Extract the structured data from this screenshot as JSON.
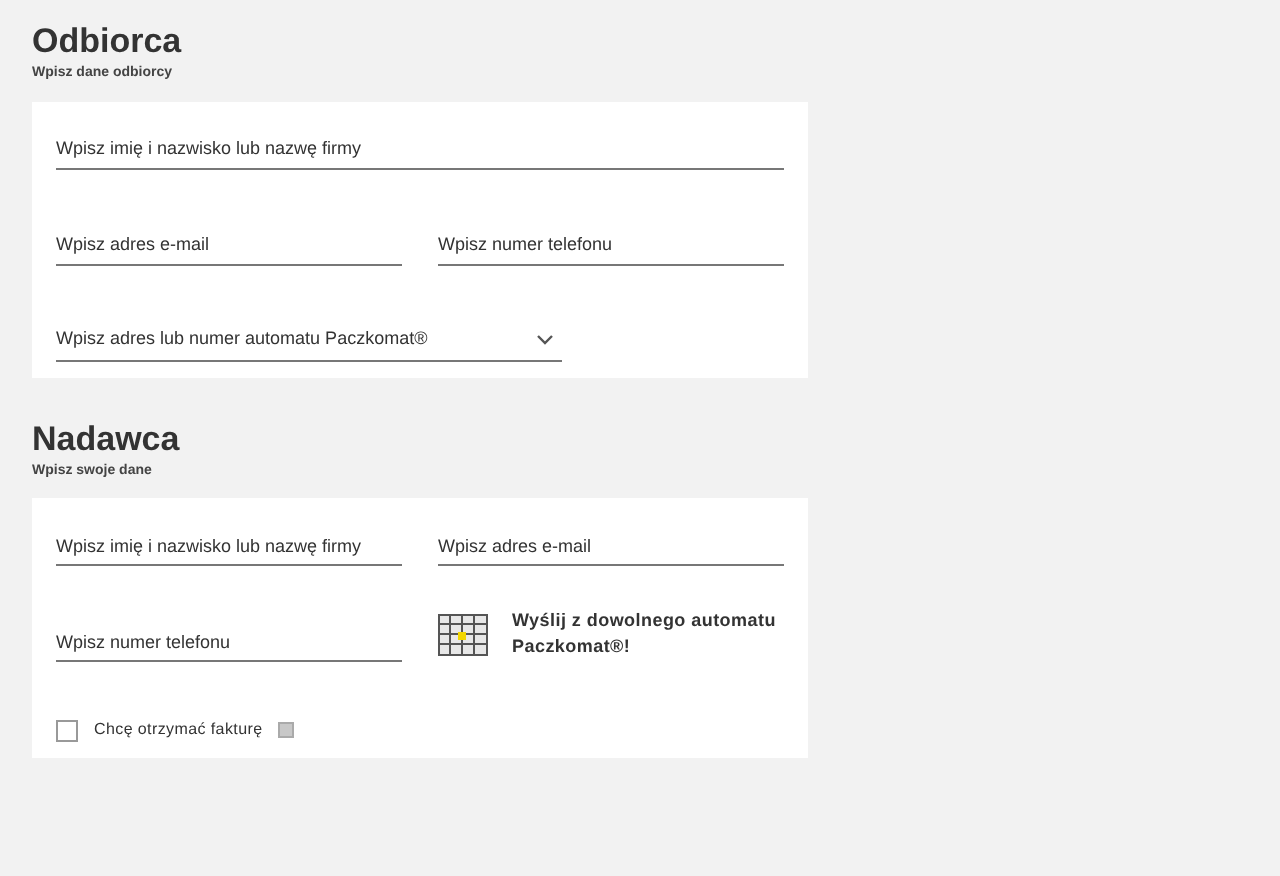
{
  "sections": [
    {
      "title": "Odbiorca",
      "subtitle": "Wpisz dane odbiorcy",
      "rows": [
        [
          {
            "kind": "text",
            "placeholder": "Wpisz imię i nazwisko lub nazwę firmy"
          }
        ],
        [
          {
            "kind": "text",
            "placeholder": "Wpisz adres e-mail"
          },
          {
            "kind": "text",
            "placeholder": "Wpisz numer telefonu"
          }
        ],
        [
          {
            "kind": "select",
            "placeholder": "Wpisz adres lub numer automatu Paczkomat®"
          }
        ]
      ]
    },
    {
      "title": "Nadawca",
      "subtitle": "Wpisz swoje dane",
      "rows": [
        [
          {
            "kind": "text",
            "placeholder": "Wpisz imię i nazwisko lub nazwę firmy"
          },
          {
            "kind": "text",
            "placeholder": "Wpisz adres e-mail"
          }
        ],
        [
          {
            "kind": "text",
            "placeholder": "Wpisz numer telefonu"
          },
          {
            "kind": "promo",
            "text": "Wyślij z dowolnego automatu Paczkomat®!"
          }
        ],
        [
          {
            "kind": "checkbox",
            "label": "Chcę otrzymać fakturę",
            "checked": false
          }
        ]
      ]
    }
  ]
}
